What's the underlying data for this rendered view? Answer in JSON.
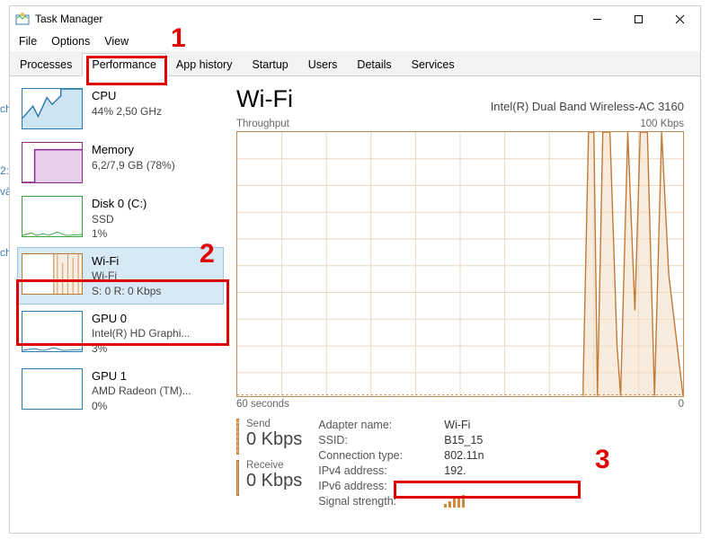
{
  "window": {
    "title": "Task Manager"
  },
  "menu": {
    "file": "File",
    "options": "Options",
    "view": "View"
  },
  "tabs": {
    "processes": "Processes",
    "performance": "Performance",
    "apphistory": "App history",
    "startup": "Startup",
    "users": "Users",
    "details": "Details",
    "services": "Services"
  },
  "sidebar": {
    "cpu": {
      "name": "CPU",
      "line1": "44% 2,50 GHz"
    },
    "mem": {
      "name": "Memory",
      "line1": "6,2/7,9 GB (78%)"
    },
    "disk": {
      "name": "Disk 0 (C:)",
      "line1": "SSD",
      "line2": "1%"
    },
    "wifi": {
      "name": "Wi-Fi",
      "line1": "Wi-Fi",
      "line2": "S: 0 R: 0 Kbps"
    },
    "gpu0": {
      "name": "GPU 0",
      "line1": "Intel(R) HD Graphi...",
      "line2": "3%"
    },
    "gpu1": {
      "name": "GPU 1",
      "line1": "AMD Radeon (TM)...",
      "line2": "0%"
    }
  },
  "main": {
    "title": "Wi-Fi",
    "adapter_desc": "Intel(R) Dual Band Wireless-AC 3160",
    "chart": {
      "label": "Throughput",
      "ymax": "100 Kbps",
      "xleft": "60 seconds",
      "xright": "0"
    },
    "send": {
      "label": "Send",
      "value": "0 Kbps"
    },
    "receive": {
      "label": "Receive",
      "value": "0 Kbps"
    },
    "details": {
      "adapter_name_k": "Adapter name:",
      "adapter_name_v": "Wi-Fi",
      "ssid_k": "SSID:",
      "ssid_v": "B15_15",
      "conn_k": "Connection type:",
      "conn_v": "802.11n",
      "ipv4_k": "IPv4 address:",
      "ipv4_v": "192.",
      "ipv6_k": "IPv6 address:",
      "ipv6_v": "",
      "signal_k": "Signal strength:"
    }
  },
  "annotations": {
    "n1": "1",
    "n2": "2",
    "n3": "3"
  },
  "edge": {
    "a": "ch",
    "b": "2:",
    "c": "và",
    "d": "ch"
  },
  "chart_data": {
    "type": "line",
    "title": "Throughput",
    "xlabel": "seconds",
    "x_range": [
      60,
      0
    ],
    "ylabel": "Kbps",
    "ylim": [
      0,
      100
    ],
    "series": [
      {
        "name": "Send",
        "values_kbps_est": [
          0,
          0,
          0,
          0,
          0,
          0,
          0,
          0,
          0,
          0,
          0,
          0,
          0,
          0,
          0,
          0,
          0,
          0,
          0,
          0,
          0,
          0,
          0,
          0,
          0,
          0,
          0,
          0,
          0,
          0,
          0,
          0,
          0,
          0,
          0,
          0,
          0,
          0,
          0,
          0,
          0,
          0,
          0,
          0,
          0,
          0,
          0,
          0,
          0,
          0,
          0,
          0,
          0,
          0,
          0,
          0,
          0,
          0,
          0,
          0
        ]
      },
      {
        "name": "Receive",
        "values_kbps_est": [
          0,
          0,
          0,
          0,
          0,
          0,
          0,
          0,
          0,
          0,
          0,
          0,
          0,
          0,
          0,
          0,
          0,
          0,
          0,
          0,
          0,
          0,
          0,
          0,
          0,
          0,
          0,
          0,
          0,
          0,
          0,
          0,
          0,
          0,
          0,
          0,
          0,
          0,
          0,
          0,
          0,
          0,
          0,
          0,
          0,
          0,
          5,
          100,
          100,
          20,
          100,
          100,
          10,
          100,
          30,
          100,
          100,
          40,
          100,
          0
        ]
      }
    ]
  }
}
